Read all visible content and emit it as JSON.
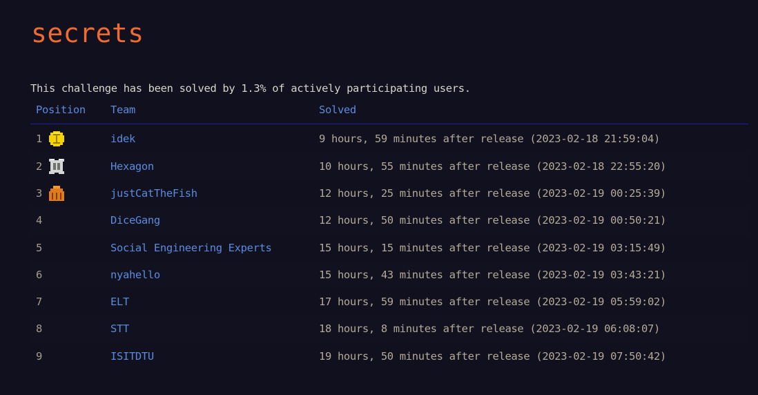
{
  "page": {
    "title": "secrets",
    "summary": "This challenge has been solved by 1.3% of actively participating users."
  },
  "table": {
    "headers": {
      "position": "Position",
      "team": "Team",
      "solved": "Solved"
    },
    "rows": [
      {
        "position": "1",
        "medal": "gold-medal",
        "team": "idek",
        "solved": "9 hours, 59 minutes after release (2023-02-18 21:59:04)"
      },
      {
        "position": "2",
        "medal": "silver-medal",
        "team": "Hexagon",
        "solved": "10 hours, 55 minutes after release (2023-02-18 22:55:20)"
      },
      {
        "position": "3",
        "medal": "bronze-medal",
        "team": "justCatTheFish",
        "solved": "12 hours, 25 minutes after release (2023-02-19 00:25:39)"
      },
      {
        "position": "4",
        "medal": null,
        "team": "DiceGang",
        "solved": "12 hours, 50 minutes after release (2023-02-19 00:50:21)"
      },
      {
        "position": "5",
        "medal": null,
        "team": "Social Engineering Experts",
        "solved": "15 hours, 15 minutes after release (2023-02-19 03:15:49)"
      },
      {
        "position": "6",
        "medal": null,
        "team": "nyahello",
        "solved": "15 hours, 43 minutes after release (2023-02-19 03:43:21)"
      },
      {
        "position": "7",
        "medal": null,
        "team": "ELT",
        "solved": "17 hours, 59 minutes after release (2023-02-19 05:59:02)"
      },
      {
        "position": "8",
        "medal": null,
        "team": "STT",
        "solved": "18 hours, 8 minutes after release (2023-02-19 06:08:07)"
      },
      {
        "position": "9",
        "medal": null,
        "team": "ISITDTU",
        "solved": "19 hours, 50 minutes after release (2023-02-19 07:50:42)"
      }
    ]
  },
  "colors": {
    "background": "#10101e",
    "title": "#f06a32",
    "link": "#5b8bde",
    "text": "#b5aa98",
    "divider": "#1e1f9a",
    "gold": "#f5d300",
    "silver": "#d4d6d4",
    "bronze": "#e07a1a"
  }
}
